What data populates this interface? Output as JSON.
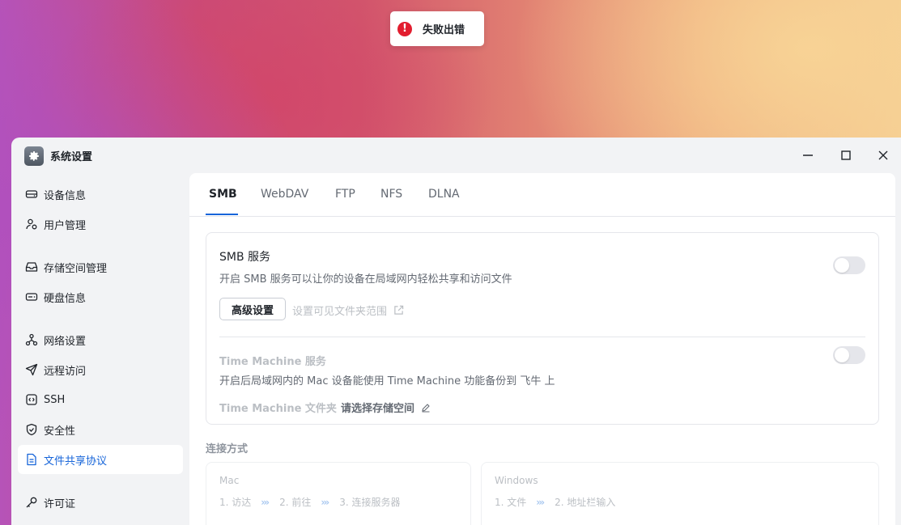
{
  "toast": {
    "icon": "!",
    "text": "失败出错"
  },
  "window": {
    "title": "系统设置"
  },
  "sidebar": {
    "items": [
      {
        "label": "设备信息"
      },
      {
        "label": "用户管理"
      },
      {
        "label": "存储空间管理"
      },
      {
        "label": "硬盘信息"
      },
      {
        "label": "网络设置"
      },
      {
        "label": "远程访问"
      },
      {
        "label": "SSH"
      },
      {
        "label": "安全性"
      },
      {
        "label": "文件共享协议"
      },
      {
        "label": "许可证"
      }
    ],
    "active_index": 8
  },
  "tabs": [
    {
      "label": "SMB"
    },
    {
      "label": "WebDAV"
    },
    {
      "label": "FTP"
    },
    {
      "label": "NFS"
    },
    {
      "label": "DLNA"
    }
  ],
  "smb": {
    "title": "SMB 服务",
    "description": "开启 SMB 服务可以让你的设备在局域网内轻松共享和访问文件",
    "enabled": false,
    "advanced_button": "高级设置",
    "visible_folders_link": "设置可见文件夹范围"
  },
  "time_machine": {
    "title": "Time Machine 服务",
    "description": "开启后局域网内的 Mac 设备能使用 Time Machine 功能备份到 飞牛 上",
    "enabled": false,
    "folder_label": "Time Machine 文件夹",
    "folder_value": "请选择存储空间"
  },
  "connection": {
    "title": "连接方式",
    "mac": {
      "name": "Mac",
      "step1": "1. 访达",
      "step2": "2. 前往",
      "step3": "3. 连接服务器"
    },
    "windows": {
      "name": "Windows",
      "step1": "1. 文件",
      "step2": "2. 地址栏输入"
    },
    "arrow": "›››"
  },
  "colors": {
    "accent": "#1765d9",
    "error": "#e21d2f",
    "sidebar_bg": "#f2f3f5"
  }
}
